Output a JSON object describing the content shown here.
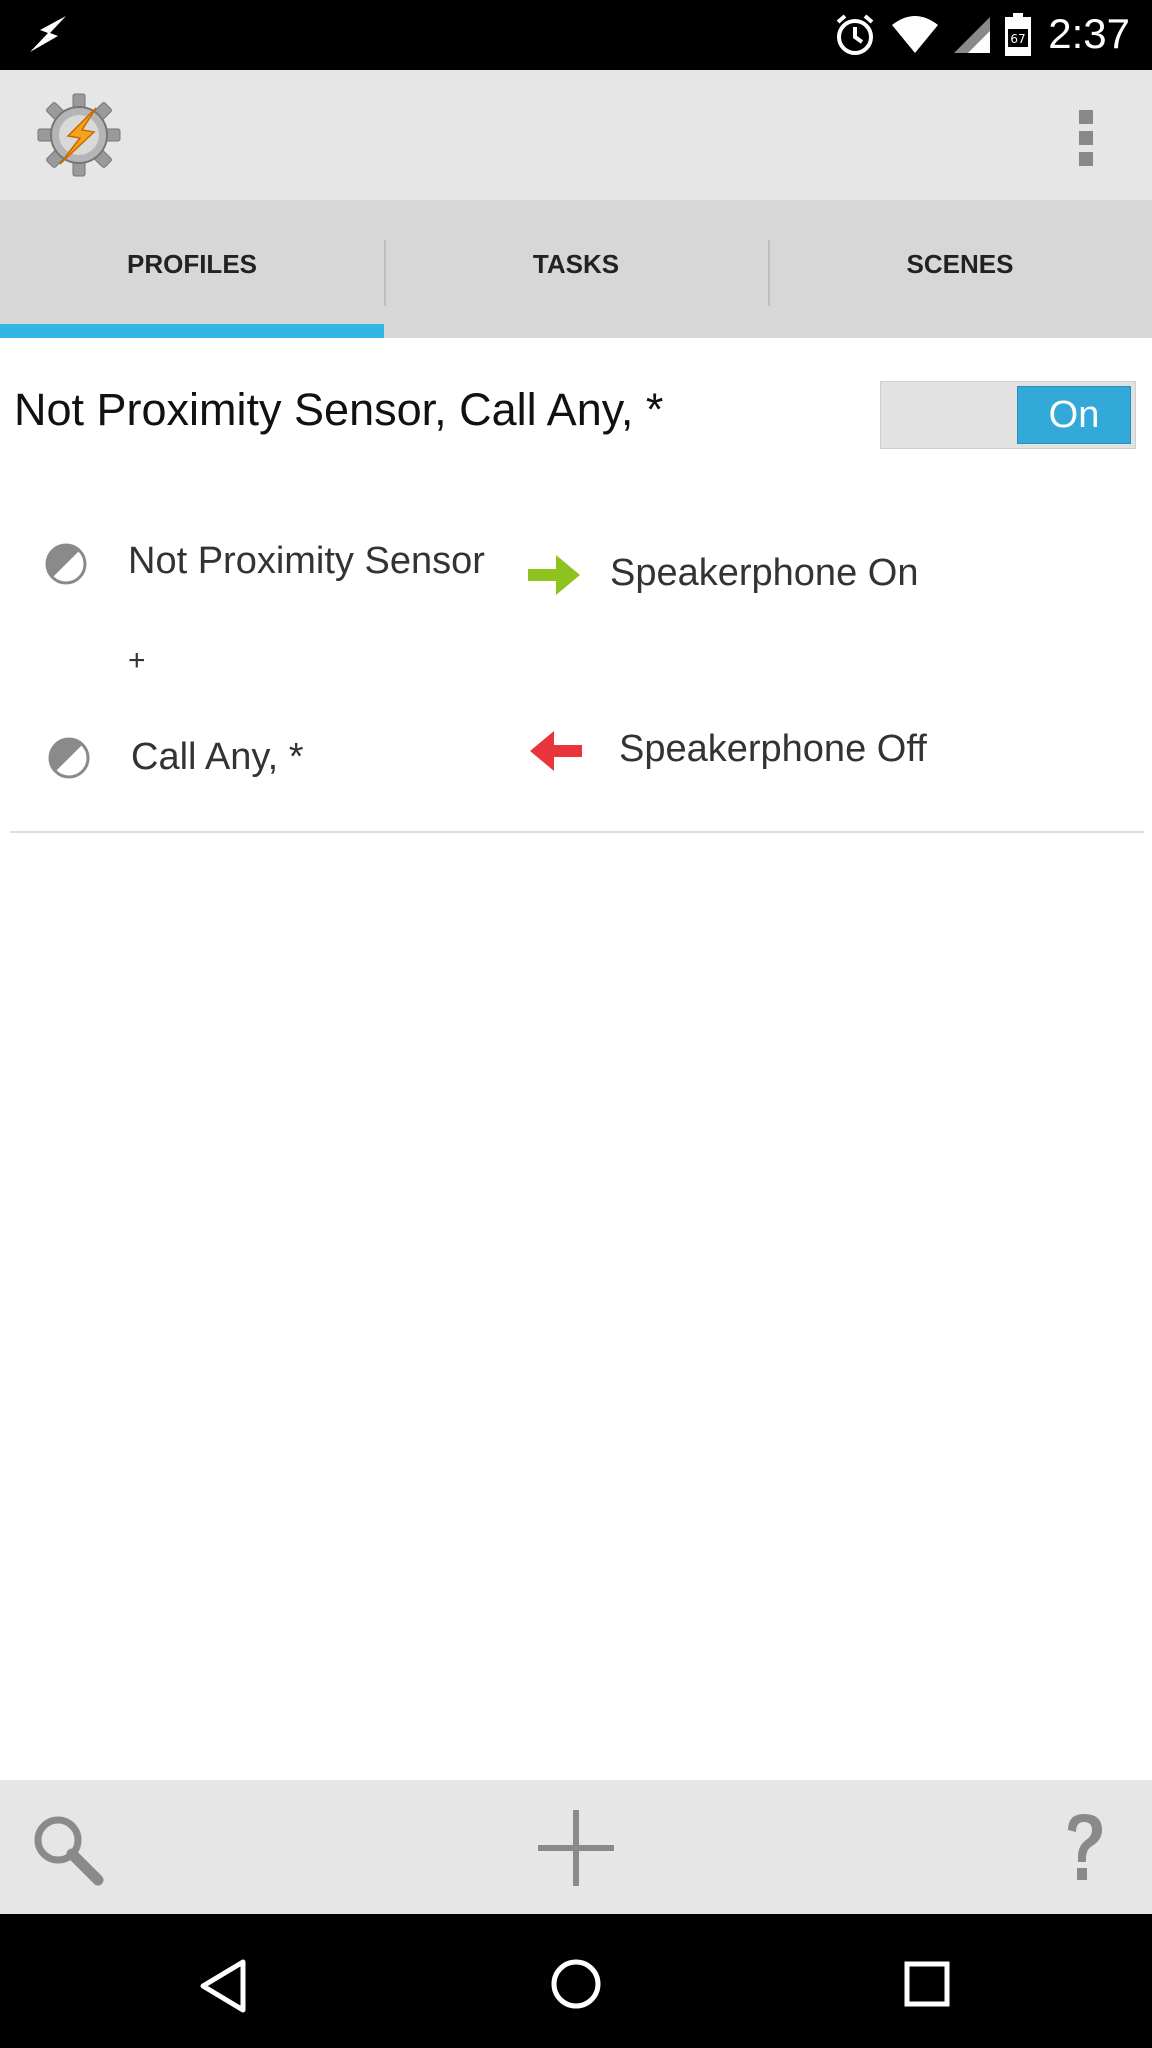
{
  "status_bar": {
    "time": "2:37",
    "battery_level": "67",
    "icons": [
      "bolt-icon",
      "alarm-icon",
      "wifi-icon",
      "signal-icon",
      "battery-icon"
    ]
  },
  "app_bar": {
    "logo": "tasker-gear-bolt-logo",
    "overflow_icon": "more-vert-icon"
  },
  "tabs": [
    {
      "label": "PROFILES",
      "active": true
    },
    {
      "label": "TASKS",
      "active": false
    },
    {
      "label": "SCENES",
      "active": false
    }
  ],
  "profile": {
    "title": "Not Proximity Sensor, Call Any, *",
    "toggle_label": "On",
    "contexts": [
      {
        "label": "Not Proximity Sensor",
        "icon": "half-circle-icon"
      },
      {
        "label": "Call Any, *",
        "icon": "half-circle-icon"
      }
    ],
    "joiner": "+",
    "tasks": [
      {
        "label": "Speakerphone On",
        "direction": "enter",
        "color": "#8dc21f"
      },
      {
        "label": "Speakerphone Off",
        "direction": "exit",
        "color": "#e8353b"
      }
    ]
  },
  "bottom_bar": {
    "icons": [
      "search-icon",
      "add-icon",
      "help-icon"
    ]
  },
  "nav_bar": {
    "icons": [
      "back-icon",
      "home-icon",
      "recents-icon"
    ]
  },
  "colors": {
    "accent": "#33b5e5",
    "toggle_on": "#33a9d9"
  }
}
